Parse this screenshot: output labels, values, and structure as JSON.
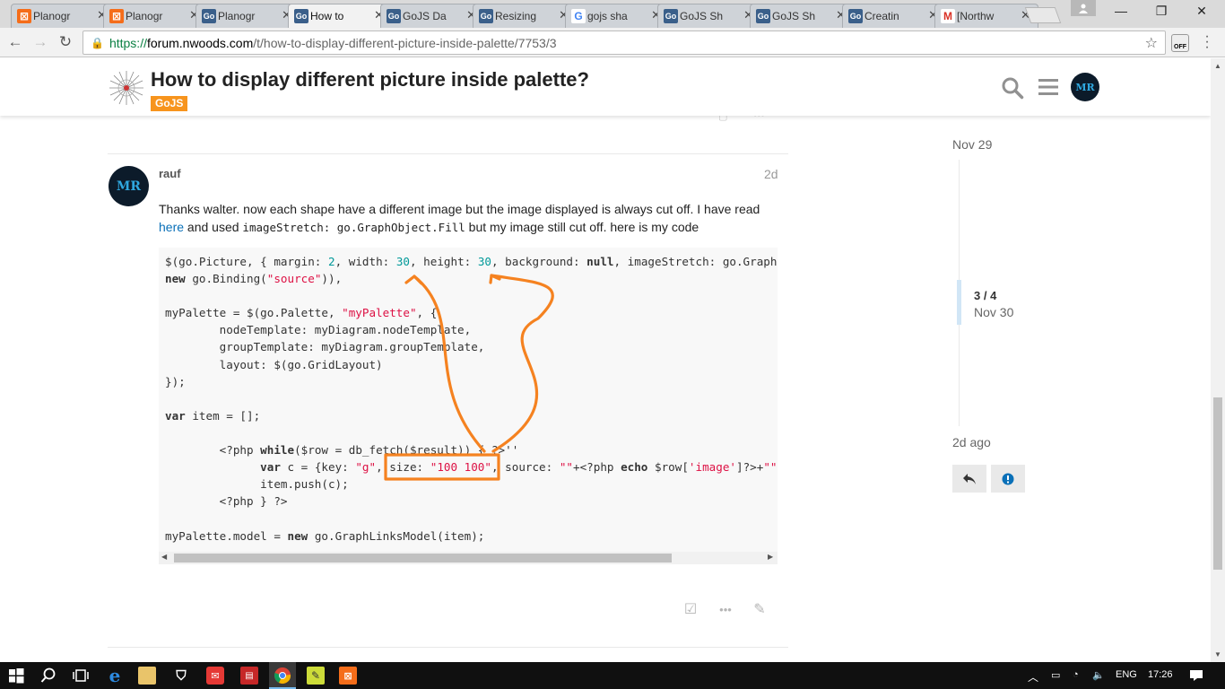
{
  "browser": {
    "tabs": [
      {
        "title": "Planogr",
        "icon": "xampp-icon",
        "color": "#f56d1a",
        "active": false
      },
      {
        "title": "Planogr",
        "icon": "xampp-icon",
        "color": "#f56d1a",
        "active": false
      },
      {
        "title": "Planogr",
        "icon": "gojs-icon",
        "color": "#3a5f8a",
        "active": false
      },
      {
        "title": "How to",
        "icon": "gojs-icon",
        "color": "#3a5f8a",
        "active": true
      },
      {
        "title": "GoJS Da",
        "icon": "gojs-icon",
        "color": "#3a5f8a",
        "active": false
      },
      {
        "title": "Resizing",
        "icon": "gojs-icon",
        "color": "#3a5f8a",
        "active": false
      },
      {
        "title": "gojs sha",
        "icon": "google-icon",
        "color": "#4285f4",
        "active": false
      },
      {
        "title": "GoJS Sh",
        "icon": "gojs-icon",
        "color": "#3a5f8a",
        "active": false
      },
      {
        "title": "GoJS Sh",
        "icon": "gojs-icon",
        "color": "#3a5f8a",
        "active": false
      },
      {
        "title": "Creatin",
        "icon": "gojs-icon",
        "color": "#3a5f8a",
        "active": false
      },
      {
        "title": "[Northw",
        "icon": "gmail-icon",
        "color": "#d93025",
        "active": false
      }
    ],
    "close_glyph": "✕",
    "favicon_go": "Go",
    "favicon_google": "G",
    "favicon_gmail": "M",
    "favicon_xampp": "⊠",
    "url_scheme": "https://",
    "url_host": "forum.nwoods.com",
    "url_path": "/t/how-to-display-different-picture-inside-palette/7753/3",
    "extension_label": "OFF"
  },
  "topic": {
    "title": "How to display different picture inside palette?",
    "category": "GoJS",
    "avatar_text": "MR"
  },
  "post": {
    "username": "rauf",
    "date": "2d",
    "avatar_text": "MR",
    "text_1": "Thanks walter. now each shape have a different image but the image displayed is always cut off. I have read",
    "link": "here",
    "text_2": " and used ",
    "inline_code": "imageStretch: go.GraphObject.Fill",
    "text_3": " but my image still cut off. here is my code"
  },
  "timeline": {
    "top_date": "Nov 29",
    "position": "3 / 4",
    "position_date": "Nov 30",
    "bottom_date": "2d ago"
  },
  "taskbar": {
    "language": "ENG",
    "time": "17:26"
  },
  "accent": {
    "annotation_orange": "#f58220",
    "category_orange": "#f7941d",
    "link_blue": "#0a70b8"
  }
}
